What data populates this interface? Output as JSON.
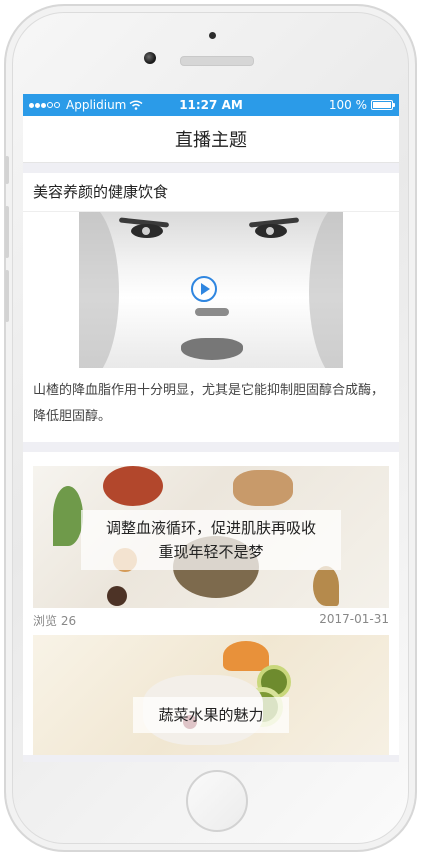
{
  "status_bar": {
    "carrier": "Applidium",
    "time": "11:27 AM",
    "battery": "100 %",
    "battery_level": 1.0,
    "signal_dots_filled": 3,
    "signal_dots_total": 5
  },
  "nav": {
    "title": "直播主题"
  },
  "featured": {
    "title": "美容养颜的健康饮食",
    "description": "山楂的降血脂作用十分明显，尤其是它能抑制胆固醇合成酶，降低胆固醇。"
  },
  "topics": [
    {
      "title": "调整血液循环，促进肌肤再吸收\n重现年轻不是梦",
      "views_label": "浏览",
      "views": "26",
      "date": "2017-01-31"
    },
    {
      "title": "蔬菜水果的魅力"
    }
  ],
  "colors": {
    "accent": "#2b9be8",
    "play": "#2f86e0"
  },
  "icons": {
    "play": "play-icon",
    "wifi": "wifi-icon",
    "battery": "battery-icon"
  }
}
